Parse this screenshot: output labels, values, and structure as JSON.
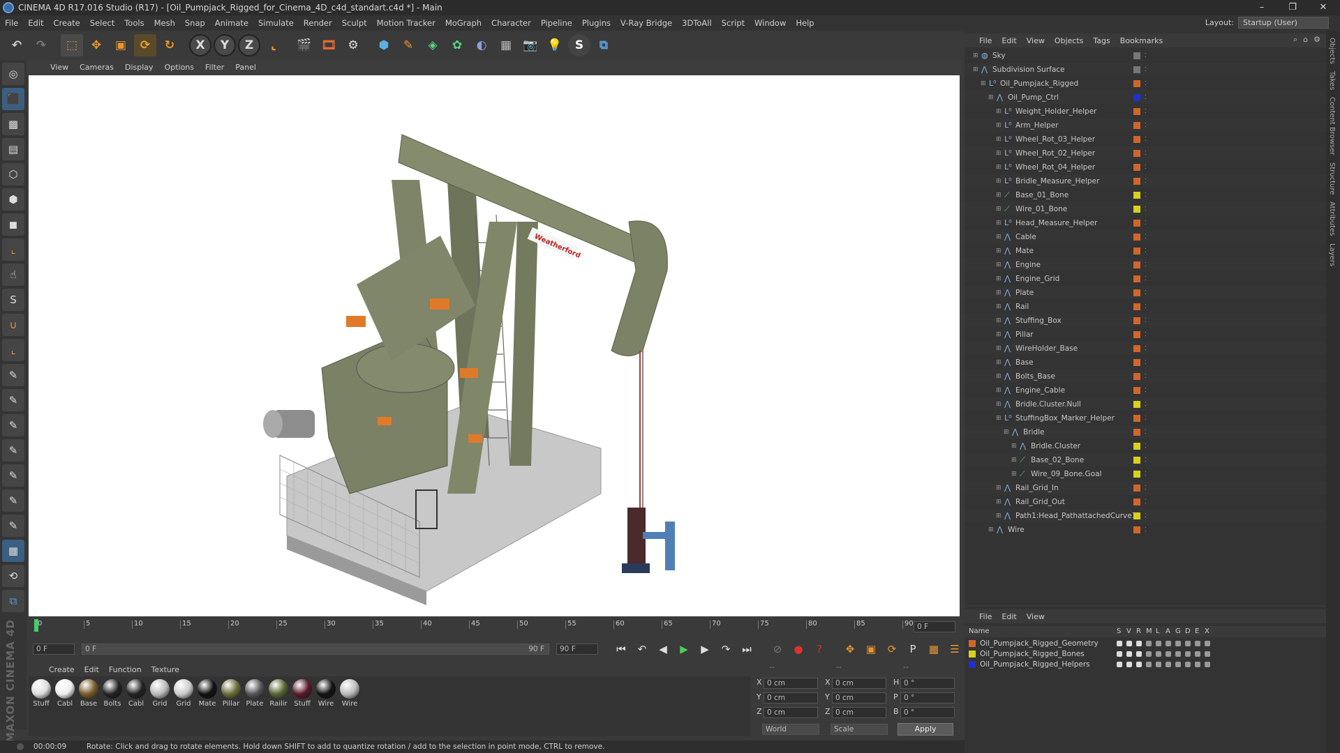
{
  "window": {
    "title": "CINEMA 4D R17.016 Studio (R17) - [Oil_Pumpjack_Rigged_for_Cinema_4D_c4d_standart.c4d *] - Main",
    "minimize": "–",
    "maximize": "❐",
    "close": "✕"
  },
  "menu": [
    "File",
    "Edit",
    "Create",
    "Select",
    "Tools",
    "Mesh",
    "Snap",
    "Animate",
    "Simulate",
    "Render",
    "Sculpt",
    "Motion Tracker",
    "MoGraph",
    "Character",
    "Pipeline",
    "Plugins",
    "V-Ray Bridge",
    "3DToAll",
    "Script",
    "Window",
    "Help"
  ],
  "layout": {
    "label": "Layout:",
    "value": "Startup (User)"
  },
  "viewport_menu": [
    "View",
    "Cameras",
    "Display",
    "Options",
    "Filter",
    "Panel"
  ],
  "timeline": {
    "ticks": [
      "0",
      "5",
      "10",
      "15",
      "20",
      "25",
      "30",
      "35",
      "40",
      "45",
      "50",
      "55",
      "60",
      "65",
      "70",
      "75",
      "80",
      "85",
      "90"
    ],
    "frame_display": "0 F",
    "start_field": "0 F",
    "range_start": "0 F",
    "range_end": "90 F",
    "end_field": "90 F"
  },
  "material_menu": [
    "Create",
    "Edit",
    "Function",
    "Texture"
  ],
  "materials": [
    "Stuff",
    "Cabl",
    "Base",
    "Bolts",
    "Cabl",
    "Grid",
    "Grid",
    "Mate",
    "Pillar",
    "Plate",
    "Railir",
    "Stuff",
    "Wire",
    "Wire"
  ],
  "coords": {
    "header_left": "--",
    "header_mid": "--",
    "header_right": "--",
    "rows": [
      {
        "a": "X",
        "av": "0 cm",
        "b": "X",
        "bv": "0 cm",
        "c": "H",
        "cv": "0 °"
      },
      {
        "a": "Y",
        "av": "0 cm",
        "b": "Y",
        "bv": "0 cm",
        "c": "P",
        "cv": "0 °"
      },
      {
        "a": "Z",
        "av": "0 cm",
        "b": "Z",
        "bv": "0 cm",
        "c": "B",
        "cv": "0 °"
      }
    ],
    "mode1": "World",
    "mode2": "Scale",
    "apply": "Apply"
  },
  "status": {
    "time": "00:00:09",
    "message": "Rotate: Click and drag to rotate elements. Hold down SHIFT to add to quantize rotation / add to the selection in point mode, CTRL to remove."
  },
  "object_menu": [
    "File",
    "Edit",
    "View",
    "Objects",
    "Tags",
    "Bookmarks"
  ],
  "objects": [
    {
      "name": "Sky",
      "depth": 0,
      "color": "#777777"
    },
    {
      "name": "Subdivision Surface",
      "depth": 0,
      "color": "#777777"
    },
    {
      "name": "Oil_Pumpjack_Rigged",
      "depth": 1,
      "color": "#d0662a"
    },
    {
      "name": "Oil_Pump_Ctrl",
      "depth": 2,
      "color": "#1f2fd0"
    },
    {
      "name": "Weight_Holder_Helper",
      "depth": 3,
      "color": "#d0662a"
    },
    {
      "name": "Arm_Helper",
      "depth": 3,
      "color": "#d0662a"
    },
    {
      "name": "Wheel_Rot_03_Helper",
      "depth": 3,
      "color": "#d0662a"
    },
    {
      "name": "Wheel_Rot_02_Helper",
      "depth": 3,
      "color": "#d0662a"
    },
    {
      "name": "Wheel_Rot_04_Helper",
      "depth": 3,
      "color": "#d0662a"
    },
    {
      "name": "Bridle_Measure_Helper",
      "depth": 3,
      "color": "#d0662a"
    },
    {
      "name": "Base_01_Bone",
      "depth": 3,
      "color": "#d8d020"
    },
    {
      "name": "Wire_01_Bone",
      "depth": 3,
      "color": "#d8d020"
    },
    {
      "name": "Head_Measure_Helper",
      "depth": 3,
      "color": "#d0662a"
    },
    {
      "name": "Cable",
      "depth": 3,
      "color": "#d0662a"
    },
    {
      "name": "Mate",
      "depth": 3,
      "color": "#d0662a"
    },
    {
      "name": "Engine",
      "depth": 3,
      "color": "#d0662a"
    },
    {
      "name": "Engine_Grid",
      "depth": 3,
      "color": "#d0662a"
    },
    {
      "name": "Plate",
      "depth": 3,
      "color": "#d0662a"
    },
    {
      "name": "Rail",
      "depth": 3,
      "color": "#d0662a"
    },
    {
      "name": "Stuffing_Box",
      "depth": 3,
      "color": "#d0662a"
    },
    {
      "name": "Pillar",
      "depth": 3,
      "color": "#d0662a"
    },
    {
      "name": "WireHolder_Base",
      "depth": 3,
      "color": "#d0662a"
    },
    {
      "name": "Base",
      "depth": 3,
      "color": "#d0662a"
    },
    {
      "name": "Bolts_Base",
      "depth": 3,
      "color": "#d0662a"
    },
    {
      "name": "Engine_Cable",
      "depth": 3,
      "color": "#d0662a"
    },
    {
      "name": "Bridle.Cluster.Null",
      "depth": 3,
      "color": "#d8d020"
    },
    {
      "name": "StuffingBox_Marker_Helper",
      "depth": 3,
      "color": "#d0662a"
    },
    {
      "name": "Bridle",
      "depth": 4,
      "color": "#d0662a"
    },
    {
      "name": "Bridle.Cluster",
      "depth": 5,
      "color": "#d8d020"
    },
    {
      "name": "Base_02_Bone",
      "depth": 5,
      "color": "#d8d020"
    },
    {
      "name": "Wire_09_Bone.Goal",
      "depth": 5,
      "color": "#d8d020"
    },
    {
      "name": "Rail_Grid_In",
      "depth": 3,
      "color": "#d0662a"
    },
    {
      "name": "Rail_Grid_Out",
      "depth": 3,
      "color": "#d0662a"
    },
    {
      "name": "Path1:Head_PathattachedCurve1",
      "depth": 3,
      "color": "#d8d020"
    },
    {
      "name": "Wire",
      "depth": 2,
      "color": "#d0662a"
    }
  ],
  "layer_menu": [
    "File",
    "Edit",
    "View"
  ],
  "layer_headers": [
    "Name",
    "S",
    "V",
    "R",
    "M",
    "L",
    "A",
    "G",
    "D",
    "E",
    "X"
  ],
  "layers": [
    {
      "name": "Oil_Pumpjack_Rigged_Geometry",
      "color": "#d0662a"
    },
    {
      "name": "Oil_Pumpjack_Rigged_Bones",
      "color": "#d8d020"
    },
    {
      "name": "Oil_Pumpjack_Rigged_Helpers",
      "color": "#1f2fd0"
    }
  ],
  "side_tabs": [
    "Objects",
    "Takes",
    "Content Browser",
    "Structure",
    "Attributes",
    "Layers"
  ],
  "brand": "MAXON CINEMA 4D",
  "viewport_model": {
    "decal": "Weatherford"
  }
}
